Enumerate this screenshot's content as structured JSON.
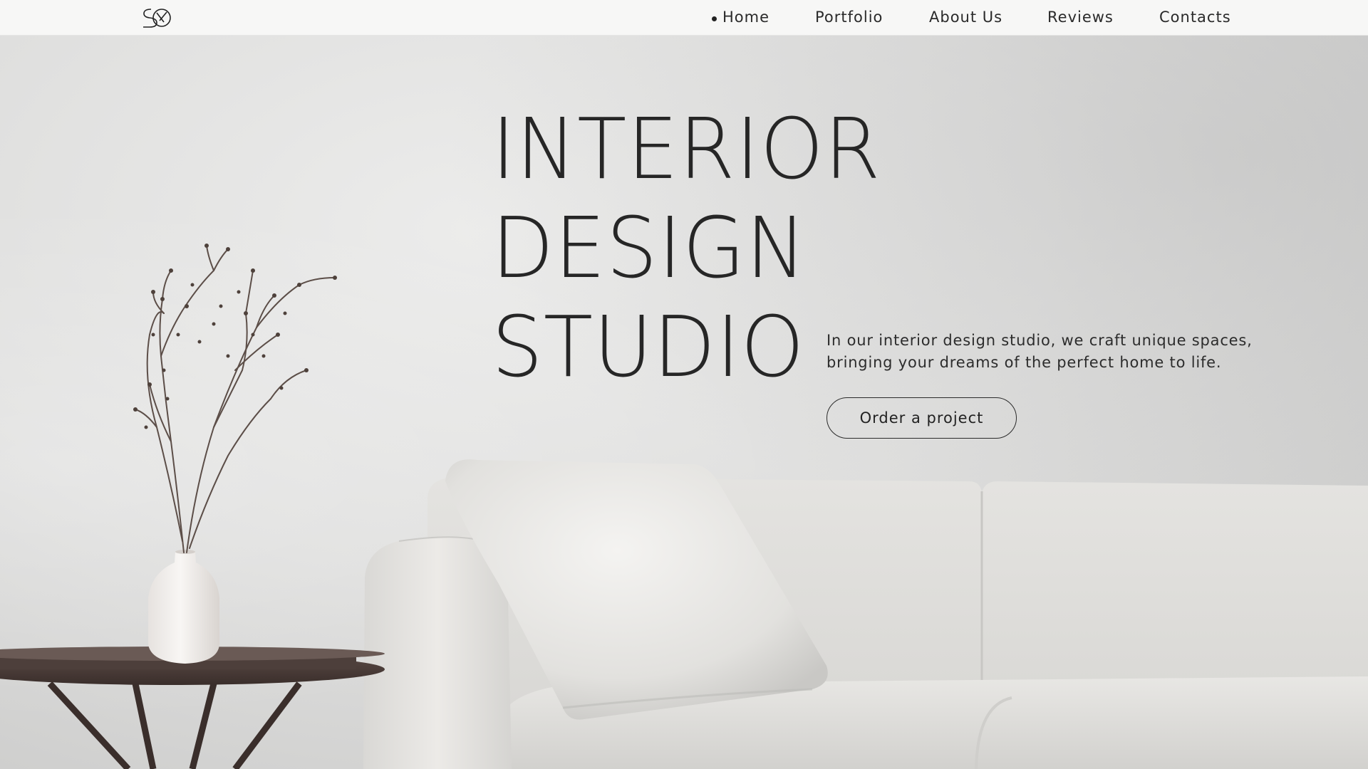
{
  "brand": {
    "logo_icon": "sk-monogram-icon"
  },
  "nav": {
    "items": [
      {
        "label": "Home",
        "active": true
      },
      {
        "label": "Portfolio",
        "active": false
      },
      {
        "label": "About Us",
        "active": false
      },
      {
        "label": "Reviews",
        "active": false
      },
      {
        "label": "Contacts",
        "active": false
      }
    ]
  },
  "hero": {
    "title_lines": [
      "INTERIOR",
      "DESIGN",
      "STUDIO"
    ],
    "tagline_line1": "In our interior design studio, we craft unique spaces,",
    "tagline_line2": "bringing your dreams of the perfect home to life.",
    "cta_label": "Order a project"
  },
  "colors": {
    "text": "#262626",
    "header_bg": "#f7f7f6",
    "wall": "#dcdcdb",
    "sofa": "#e3e2df",
    "table": "#4a3c38"
  }
}
